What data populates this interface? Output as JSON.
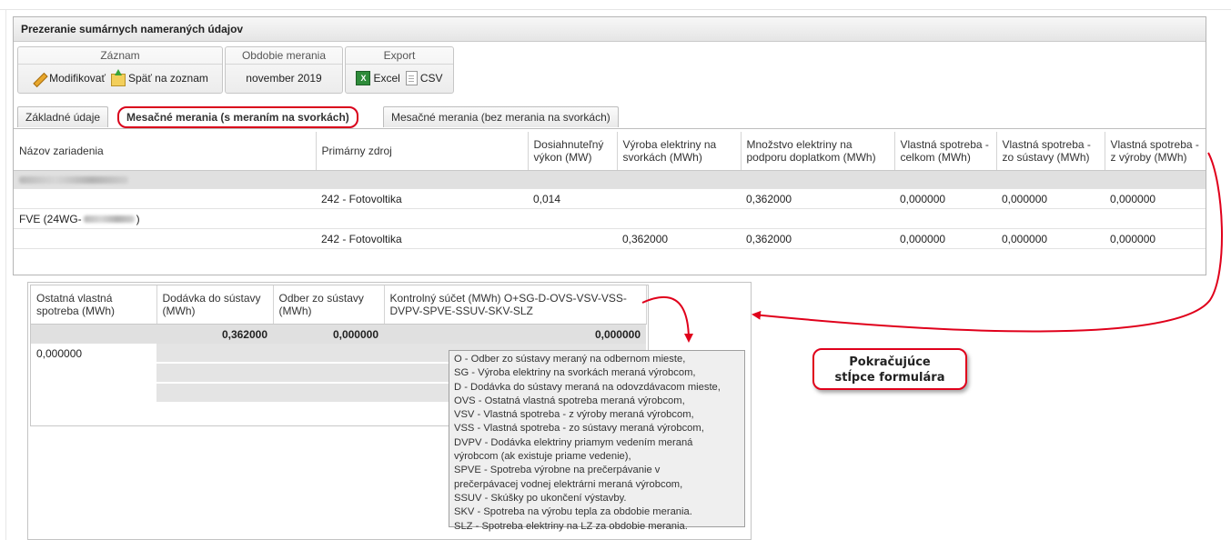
{
  "panel_title": "Prezeranie sumárnych nameraných údajov",
  "toolbar": {
    "record": {
      "title": "Záznam",
      "modify_label": "Modifikovať",
      "back_label": "Späť na zoznam"
    },
    "period": {
      "title": "Obdobie merania",
      "value": "november 2019"
    },
    "export": {
      "title": "Export",
      "excel_label": "Excel",
      "csv_label": "CSV"
    }
  },
  "tabs": [
    {
      "label": "Základné údaje"
    },
    {
      "label": "Mesačné merania (s meraním na svorkách)",
      "active": true
    },
    {
      "label": "Mesačné merania (bez merania na svorkách)"
    }
  ],
  "table1": {
    "columns": [
      "Názov zariadenia",
      "Primárny zdroj",
      "Dosiahnuteľný výkon (MW)",
      "Výroba elektriny na svorkách (MWh)",
      "Množstvo elektriny na podporu doplatkom (MWh)",
      "Vlastná spotreba - celkom (MWh)",
      "Vlastná spotreba - zo sústavy (MWh)",
      "Vlastná spotreba - z výroby (MWh)"
    ],
    "group1_label": "",
    "row1": [
      "",
      "242 - Fotovoltika",
      "0,014",
      "",
      "0,362000",
      "0,000000",
      "0,000000",
      "0,000000"
    ],
    "group2_label_prefix": "FVE (24WG-",
    "group2_label_suffix": ")",
    "row2": [
      "",
      "242 - Fotovoltika",
      "",
      "0,362000",
      "0,362000",
      "0,000000",
      "0,000000",
      "0,000000"
    ]
  },
  "table2": {
    "columns": [
      "Ostatná vlastná spotreba (MWh)",
      "Dodávka do sústavy (MWh)",
      "Odber zo sústavy (MWh)",
      "Kontrolný súčet (MWh) O+SG-D-OVS-VSV-VSS-DVPV-SPVE-SSUV-SKV-SLZ"
    ],
    "totals": [
      "",
      "0,362000",
      "0,000000",
      "0,000000"
    ],
    "row_first_value": "0,000000"
  },
  "tooltip_lines": [
    "O - Odber zo sústavy meraný na odbernom mieste,",
    "SG - Výroba elektriny na svorkách meraná výrobcom,",
    "D - Dodávka do sústavy meraná na odovzdávacom mieste,",
    "OVS - Ostatná vlastná spotreba meraná výrobcom,",
    "VSV - Vlastná spotreba - z výroby meraná výrobcom,",
    "VSS - Vlastná spotreba - zo sústavy meraná výrobcom,",
    "DVPV - Dodávka elektriny priamym vedením meraná",
    "výrobcom (ak existuje priame vedenie),",
    "SPVE - Spotreba výrobne na prečerpávanie v",
    "prečerpávacej vodnej elektrárni meraná výrobcom,",
    "SSUV - Skúšky po ukončení výstavby.",
    "SKV - Spotreba na výrobu tepla za obdobie merania.",
    "SLZ - Spotreba elektriny na LZ za obdobie merania."
  ],
  "callout": {
    "line1": "Pokračujúce",
    "line2": "stĺpce formulára"
  },
  "colors": {
    "accent_red": "#e0001b",
    "group_row": "#e0e0e0",
    "border": "#b5b5b5"
  }
}
